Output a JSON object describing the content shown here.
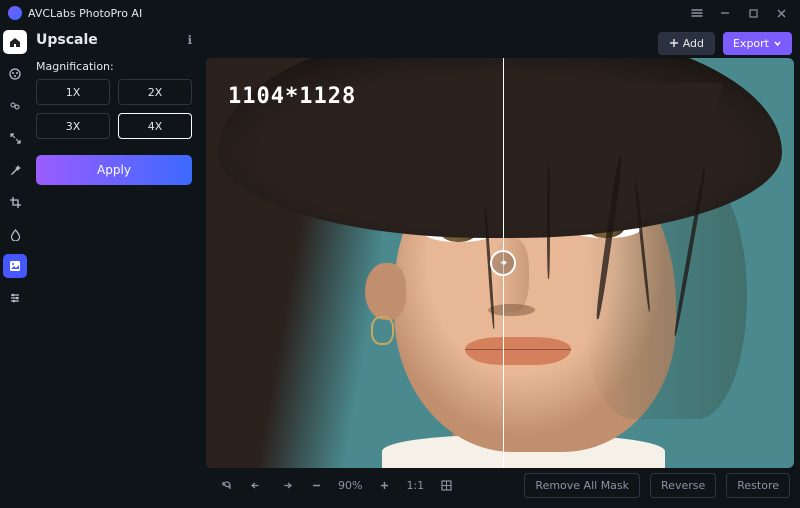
{
  "app": {
    "name": "AVCLabs PhotoPro AI"
  },
  "window": {
    "menu_icon": "menu",
    "minimize": "−",
    "maximize": "□",
    "close": "✕"
  },
  "tools": [
    {
      "id": "home",
      "icon": "home"
    },
    {
      "id": "colorize",
      "icon": "palette"
    },
    {
      "id": "face",
      "icon": "face"
    },
    {
      "id": "expand",
      "icon": "expand"
    },
    {
      "id": "magic",
      "icon": "wand"
    },
    {
      "id": "crop",
      "icon": "crop"
    },
    {
      "id": "adjust",
      "icon": "drop"
    },
    {
      "id": "upscale",
      "icon": "image",
      "active": true
    },
    {
      "id": "settings",
      "icon": "sliders"
    }
  ],
  "panel": {
    "title": "Upscale",
    "info_icon": "ℹ",
    "magnification_label": "Magnification:",
    "options": [
      {
        "label": "1X",
        "selected": false
      },
      {
        "label": "2X",
        "selected": false
      },
      {
        "label": "3X",
        "selected": false
      },
      {
        "label": "4X",
        "selected": true
      }
    ],
    "apply_label": "Apply"
  },
  "toolbar": {
    "add_label": "Add",
    "export_label": "Export"
  },
  "viewport": {
    "dimensions_text": "1104*1128",
    "slider_position_pct": 50.5
  },
  "bottom": {
    "zoom_text": "90%",
    "ratio_label": "1:1",
    "remove_mask_label": "Remove All Mask",
    "reverse_label": "Reverse",
    "restore_label": "Restore"
  }
}
